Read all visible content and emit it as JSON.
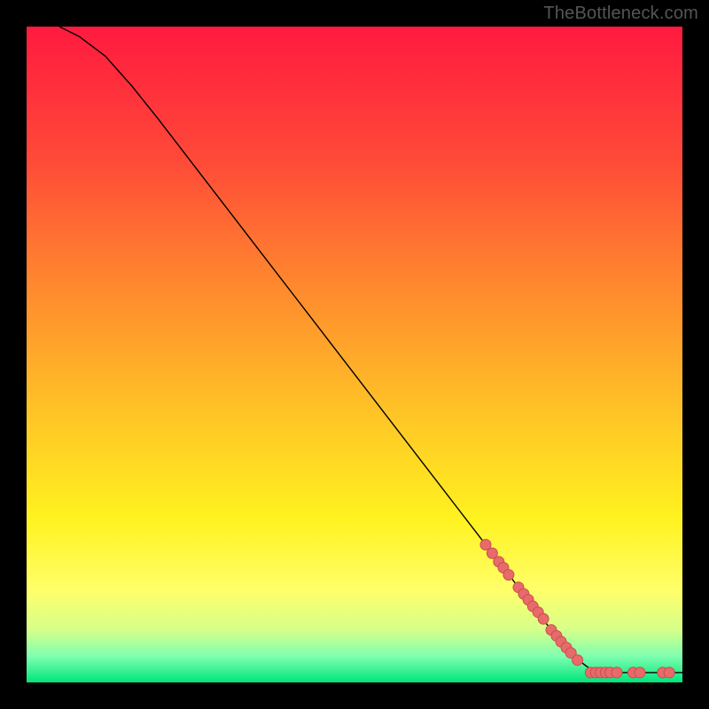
{
  "watermark": "TheBottleneck.com",
  "chart_data": {
    "type": "line",
    "title": "",
    "xlabel": "",
    "ylabel": "",
    "xlim": [
      0,
      100
    ],
    "ylim": [
      0,
      100
    ],
    "curve": [
      {
        "x": 5,
        "y": 100
      },
      {
        "x": 8,
        "y": 98.5
      },
      {
        "x": 12,
        "y": 95.5
      },
      {
        "x": 16,
        "y": 91
      },
      {
        "x": 20,
        "y": 86
      },
      {
        "x": 25,
        "y": 79.5
      },
      {
        "x": 30,
        "y": 73
      },
      {
        "x": 35,
        "y": 66.5
      },
      {
        "x": 40,
        "y": 60
      },
      {
        "x": 45,
        "y": 53.5
      },
      {
        "x": 50,
        "y": 47
      },
      {
        "x": 55,
        "y": 40.5
      },
      {
        "x": 60,
        "y": 34
      },
      {
        "x": 65,
        "y": 27.5
      },
      {
        "x": 70,
        "y": 21
      },
      {
        "x": 75,
        "y": 14.5
      },
      {
        "x": 80,
        "y": 8
      },
      {
        "x": 84,
        "y": 3.5
      },
      {
        "x": 86,
        "y": 2
      },
      {
        "x": 90,
        "y": 1.5
      },
      {
        "x": 95,
        "y": 1.5
      },
      {
        "x": 100,
        "y": 1.5
      }
    ],
    "markers": [
      {
        "x": 70,
        "y": 21
      },
      {
        "x": 71,
        "y": 19.7
      },
      {
        "x": 72,
        "y": 18.4
      },
      {
        "x": 72.7,
        "y": 17.5
      },
      {
        "x": 73.5,
        "y": 16.4
      },
      {
        "x": 75,
        "y": 14.5
      },
      {
        "x": 75.8,
        "y": 13.5
      },
      {
        "x": 76.5,
        "y": 12.6
      },
      {
        "x": 77.2,
        "y": 11.6
      },
      {
        "x": 78,
        "y": 10.7
      },
      {
        "x": 78.8,
        "y": 9.7
      },
      {
        "x": 80,
        "y": 8
      },
      {
        "x": 80.8,
        "y": 7.1
      },
      {
        "x": 81.5,
        "y": 6.2
      },
      {
        "x": 82.3,
        "y": 5.3
      },
      {
        "x": 83,
        "y": 4.5
      },
      {
        "x": 84,
        "y": 3.4
      },
      {
        "x": 86,
        "y": 1.5
      },
      {
        "x": 86.8,
        "y": 1.5
      },
      {
        "x": 87.5,
        "y": 1.5
      },
      {
        "x": 88.3,
        "y": 1.5
      },
      {
        "x": 89,
        "y": 1.5
      },
      {
        "x": 90,
        "y": 1.5
      },
      {
        "x": 92.5,
        "y": 1.5
      },
      {
        "x": 93.5,
        "y": 1.5
      },
      {
        "x": 97,
        "y": 1.5
      },
      {
        "x": 98,
        "y": 1.5
      }
    ],
    "gradient_stops": [
      {
        "offset": 0,
        "color": "#ff1a3f"
      },
      {
        "offset": 20,
        "color": "#ff4938"
      },
      {
        "offset": 40,
        "color": "#ff8a2e"
      },
      {
        "offset": 60,
        "color": "#ffc726"
      },
      {
        "offset": 75,
        "color": "#fff21f"
      },
      {
        "offset": 86,
        "color": "#ffff6a"
      },
      {
        "offset": 92,
        "color": "#d6ff8a"
      },
      {
        "offset": 96,
        "color": "#7fffb0"
      },
      {
        "offset": 100,
        "color": "#00e57d"
      }
    ],
    "curve_color": "#000000",
    "curve_width": 1.4,
    "marker_fill": "#e86a6a",
    "marker_stroke": "#c94f4f",
    "marker_radius": 6
  }
}
